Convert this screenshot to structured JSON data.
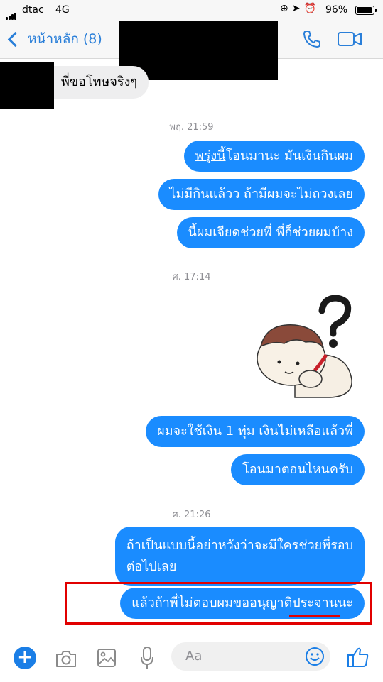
{
  "status": {
    "carrier": "dtac",
    "network": "4G",
    "battery": "96%"
  },
  "header": {
    "back_label": "หน้าหลัก (8)"
  },
  "messages": {
    "incoming_1": "พี่ขอโทษจริงๆ",
    "time_1": "พฤ. 21:59",
    "out_1_underlined": "พรุ่งนี้",
    "out_1_rest": "โอนมานะ มันเงินกินผม",
    "out_2": "ไม่มีกินแล้วว ถ้ามีผมจะไม่ถวงเลย",
    "out_3": "นี้ผมเจียดช่วยพี่ พี่ก็ช่วยผมบ้าง",
    "time_2": "ศ. 17:14",
    "sticker_icon": "question-mark-sticker-icon",
    "out_4": "ผมจะใช้เงิน 1 ทุ่ม เงินไม่เหลือแล้วพี่",
    "out_5": "โอนมาตอนไหนครับ",
    "time_3": "ศ. 21:26",
    "out_6_line1": "ถ้าเป็นแบบนี้อย่าหวังว่าจะมีใครช่วยพี่รอบ",
    "out_6_line2": "ต่อไปเลย",
    "out_7": "แล้วถ้าพี่ไม่ตอบผมขออนุญาติประจานนะ"
  },
  "composer": {
    "placeholder": "Aa"
  },
  "colors": {
    "accent": "#1a8cff",
    "highlight": "#e10000",
    "incoming_bubble": "#eeeeef"
  }
}
